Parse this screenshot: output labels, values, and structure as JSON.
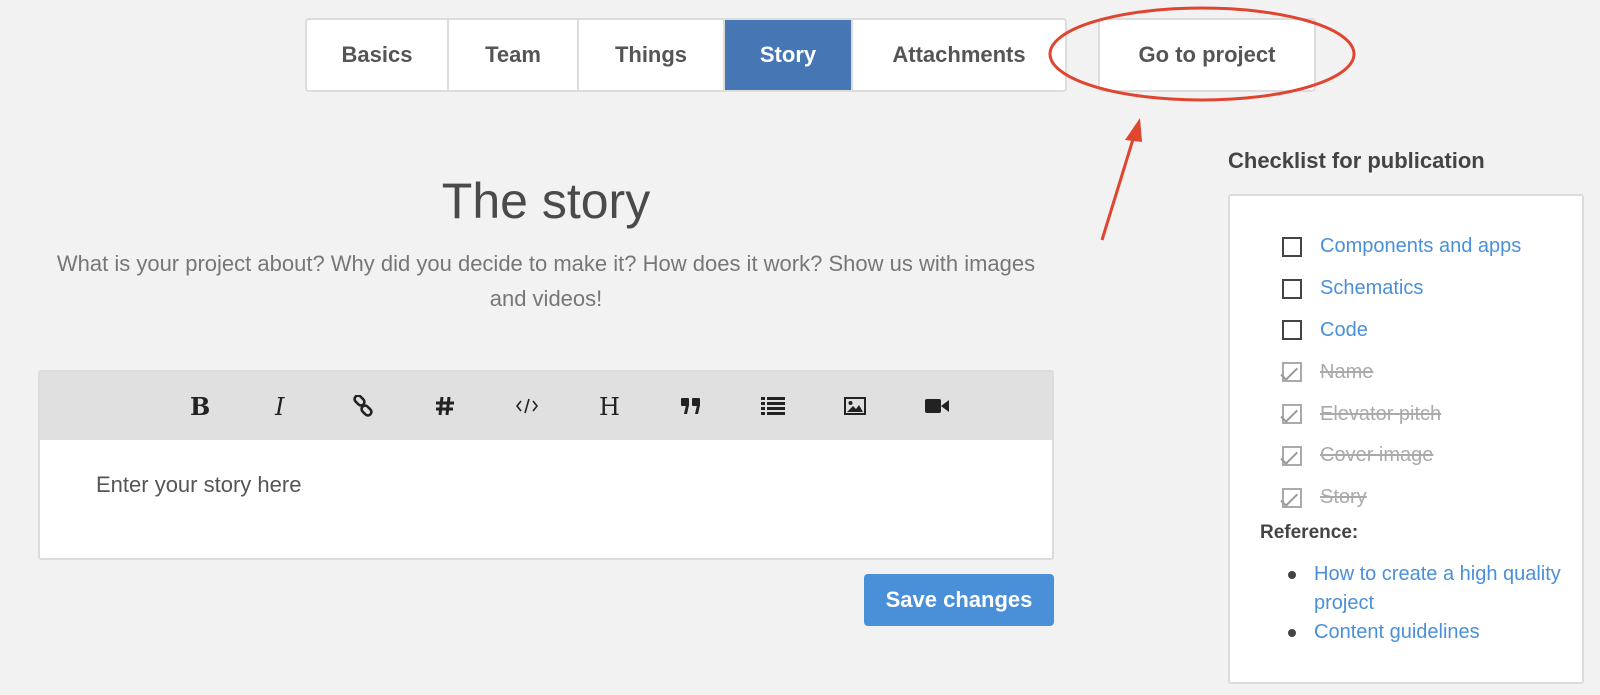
{
  "tabs": {
    "basics": "Basics",
    "team": "Team",
    "things": "Things",
    "story": "Story",
    "attachments": "Attachments",
    "go_to_project": "Go to project"
  },
  "story": {
    "title": "The story",
    "description": "What is your project about? Why did you decide to make it? How does it work? Show us with images and videos!"
  },
  "editor": {
    "tools": [
      "bold-icon",
      "italic-icon",
      "link-icon",
      "hashtag-icon",
      "code-icon",
      "heading-icon",
      "quote-icon",
      "list-icon",
      "image-icon",
      "video-icon"
    ],
    "placeholder": "Enter your story here"
  },
  "save_label": "Save changes",
  "checklist": {
    "title": "Checklist for publication",
    "items": [
      {
        "label": "Components and apps",
        "done": false
      },
      {
        "label": "Schematics",
        "done": false
      },
      {
        "label": "Code",
        "done": false
      },
      {
        "label": "Name",
        "done": true
      },
      {
        "label": "Elevator pitch",
        "done": true
      },
      {
        "label": "Cover image",
        "done": true
      },
      {
        "label": "Story",
        "done": true
      }
    ],
    "reference_title": "Reference:",
    "references": [
      "How to create a high quality project",
      "Content guidelines"
    ]
  },
  "colors": {
    "active_tab": "#4677b4",
    "link": "#4a90d9",
    "save_button": "#4a90d9",
    "annotation": "#e0452f"
  }
}
